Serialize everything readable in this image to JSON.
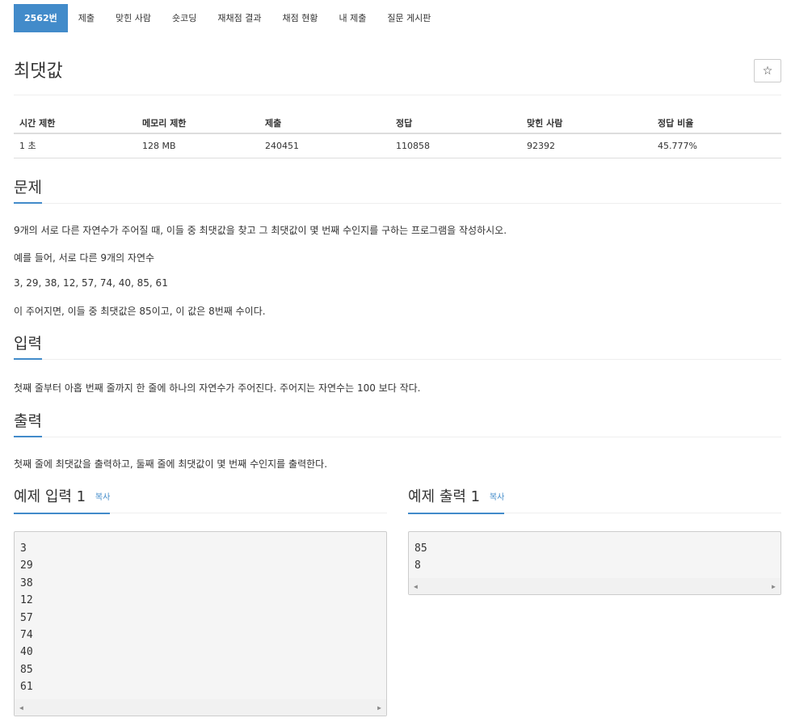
{
  "tabs": [
    {
      "label": "2562번",
      "active": true
    },
    {
      "label": "제출"
    },
    {
      "label": "맞힌 사람"
    },
    {
      "label": "숏코딩"
    },
    {
      "label": "재채점 결과"
    },
    {
      "label": "채점 현황"
    },
    {
      "label": "내 제출"
    },
    {
      "label": "질문 게시판"
    }
  ],
  "title": "최댓값",
  "star_icon": "☆",
  "info": {
    "headers": [
      "시간 제한",
      "메모리 제한",
      "제출",
      "정답",
      "맞힌 사람",
      "정답 비율"
    ],
    "values": [
      "1 초",
      "128 MB",
      "240451",
      "110858",
      "92392",
      "45.777%"
    ]
  },
  "problem": {
    "heading": "문제",
    "paragraphs": [
      "9개의 서로 다른 자연수가 주어질 때, 이들 중 최댓값을 찾고 그 최댓값이 몇 번째 수인지를 구하는 프로그램을 작성하시오.",
      "예를 들어, 서로 다른 9개의 자연수",
      "3, 29, 38, 12, 57, 74, 40, 85, 61",
      "이 주어지면, 이들 중 최댓값은 85이고, 이 값은 8번째 수이다."
    ]
  },
  "input": {
    "heading": "입력",
    "text": "첫째 줄부터 아홉 번째 줄까지 한 줄에 하나의 자연수가 주어진다. 주어지는 자연수는 100 보다 작다."
  },
  "output": {
    "heading": "출력",
    "text": "첫째 줄에 최댓값을 출력하고, 둘째 줄에 최댓값이 몇 번째 수인지를 출력한다."
  },
  "sample_input": {
    "heading": "예제 입력 1",
    "copy_label": "복사",
    "lines": [
      "3",
      "29",
      "38",
      "12",
      "57",
      "74",
      "40",
      "85",
      "61"
    ]
  },
  "sample_output": {
    "heading": "예제 출력 1",
    "copy_label": "복사",
    "lines": [
      "85",
      "8"
    ]
  },
  "scroll_left_icon": "◀",
  "scroll_right_icon": "▶"
}
